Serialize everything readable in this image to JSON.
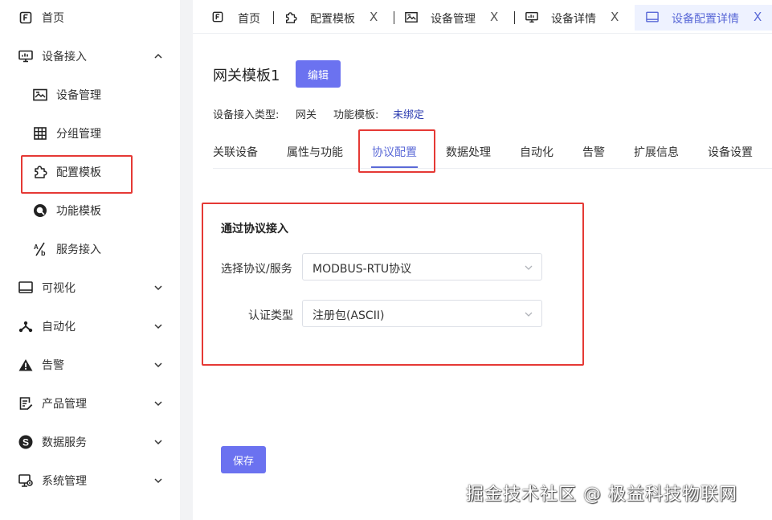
{
  "sidebar": {
    "items": [
      {
        "label": "首页",
        "icon": "home-icon"
      },
      {
        "label": "设备接入",
        "icon": "monitor-icon"
      },
      {
        "label": "设备管理",
        "icon": "image-icon"
      },
      {
        "label": "分组管理",
        "icon": "grid-icon"
      },
      {
        "label": "配置模板",
        "icon": "puzzle-icon"
      },
      {
        "label": "功能模板",
        "icon": "circle-icon"
      },
      {
        "label": "服务接入",
        "icon": "ab-icon"
      },
      {
        "label": "可视化",
        "icon": "screen-icon"
      },
      {
        "label": "自动化",
        "icon": "branch-icon"
      },
      {
        "label": "告警",
        "icon": "warning-icon"
      },
      {
        "label": "产品管理",
        "icon": "document-edit-icon"
      },
      {
        "label": "数据服务",
        "icon": "s-circle-icon"
      },
      {
        "label": "系统管理",
        "icon": "settings-monitor-icon"
      }
    ]
  },
  "tabs": [
    {
      "label": "首页",
      "icon": "home-icon"
    },
    {
      "label": "配置模板",
      "icon": "puzzle-icon",
      "close": "X"
    },
    {
      "label": "设备管理",
      "icon": "image-icon",
      "close": "X"
    },
    {
      "label": "设备详情",
      "icon": "monitor-icon",
      "close": "X"
    },
    {
      "label": "设备配置详情",
      "icon": "screen-icon",
      "close": "X",
      "active": true
    }
  ],
  "header": {
    "title": "网关模板1",
    "edit_label": "编辑",
    "access_type_label": "设备接入类型:",
    "access_type_value": "网关",
    "function_template_label": "功能模板:",
    "function_template_value": "未绑定"
  },
  "subtabs": [
    "关联设备",
    "属性与功能",
    "协议配置",
    "数据处理",
    "自动化",
    "告警",
    "扩展信息",
    "设备设置"
  ],
  "active_subtab": "协议配置",
  "form": {
    "section_title": "通过协议接入",
    "protocol_label": "选择协议/服务",
    "protocol_value": "MODBUS-RTU协议",
    "auth_label": "认证类型",
    "auth_value": "注册包(ASCII)",
    "save_label": "保存"
  },
  "watermark": "掘金技术社区 @ 极益科技物联网",
  "colors": {
    "accent": "#6b72f0",
    "active_tab": "#5b6ad7",
    "highlight": "#e53935",
    "link": "#2b3bb0"
  }
}
